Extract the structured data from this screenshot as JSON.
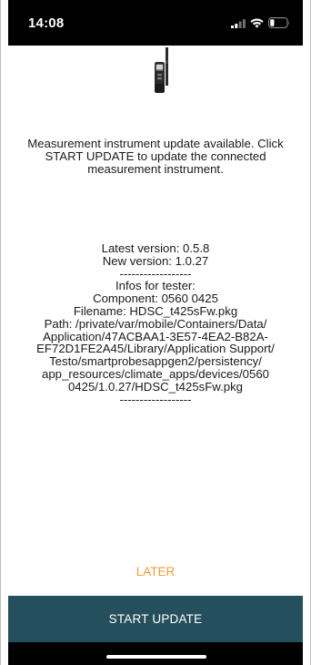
{
  "status_bar": {
    "time": "14:08",
    "signal_icon": "cellular-signal-icon",
    "wifi_icon": "wifi-icon",
    "battery_icon": "battery-icon",
    "battery_level": 0.25
  },
  "device_image": {
    "icon": "measurement-probe-device-icon"
  },
  "message": {
    "update_available": "Measurement instrument update available. Click START UPDATE to update the connected measurement instrument."
  },
  "version_info": {
    "latest_version": "Latest version: 0.5.8",
    "new_version": "New version: 1.0.27",
    "separator_top": "------------------",
    "tester_heading": "Infos for tester:",
    "component": "Component: 0560 0425",
    "filename": "Filename: HDSC_t425sFw.pkg",
    "path_lines": [
      "Path: /private/var/mobile/Containers/Data/",
      "Application/47ACBAA1-3E57-4EA2-B82A-",
      "EF72D1FE2A45/Library/Application Support/",
      "Testo/smartprobesappgen2/persistency/",
      "app_resources/climate_apps/devices/0560",
      "0425/1.0.27/HDSC_t425sFw.pkg"
    ],
    "separator_bottom": "------------------"
  },
  "actions": {
    "later_label": "LATER",
    "start_update_label": "START UPDATE"
  },
  "colors": {
    "accent_orange": "#f29b38",
    "primary_button": "#264f5d",
    "status_bar": "#000000"
  }
}
